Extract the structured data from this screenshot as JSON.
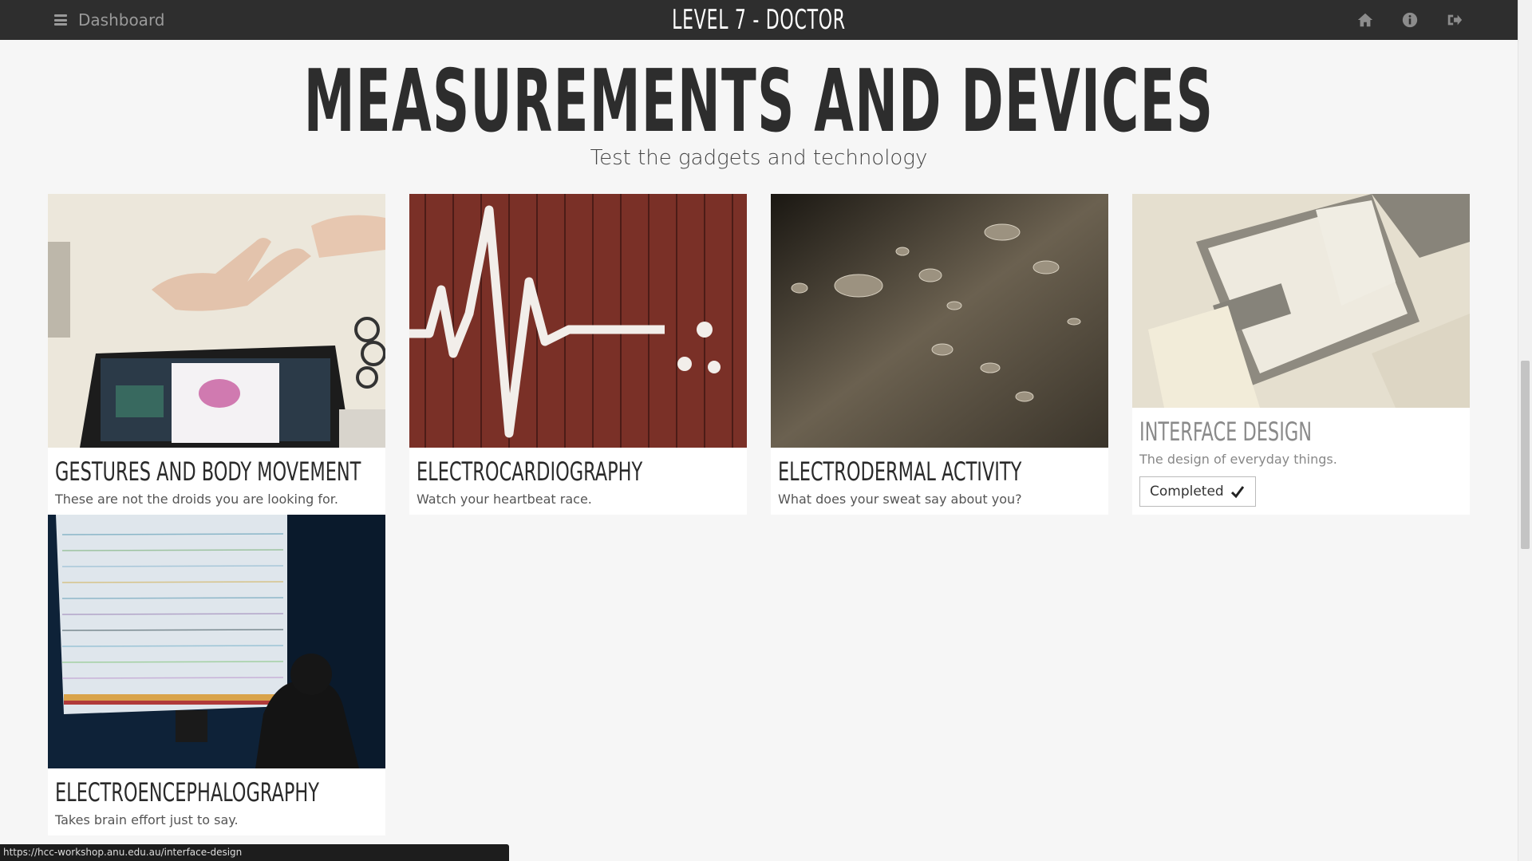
{
  "topbar": {
    "menu_label": "Dashboard",
    "title": "LEVEL 7 - DOCTOR",
    "icons": [
      "home-icon",
      "info-icon",
      "sign-out-icon"
    ]
  },
  "page": {
    "title": "MEASUREMENTS AND DEVICES",
    "subtitle": "Test the gadgets and technology"
  },
  "cards": [
    {
      "title": "GESTURES AND BODY MOVEMENT",
      "description": "These are not the droids you are looking for.",
      "completed": false
    },
    {
      "title": "ELECTROCARDIOGRAPHY",
      "description": "Watch your heartbeat race.",
      "completed": false
    },
    {
      "title": "ELECTRODERMAL ACTIVITY",
      "description": "What does your sweat say about you?",
      "completed": false
    },
    {
      "title": "INTERFACE DESIGN",
      "description": "The design of everyday things.",
      "completed": true,
      "status_label": "Completed"
    },
    {
      "title": "ELECTROENCEPHALOGRAPHY",
      "description": "Takes brain effort just to say.",
      "completed": false
    }
  ],
  "status_bar": {
    "url": "https://hcc-workshop.anu.edu.au/interface-design"
  },
  "colors": {
    "topbar": "#2e2e2e",
    "background": "#f6f6f6",
    "card": "#ffffff"
  }
}
